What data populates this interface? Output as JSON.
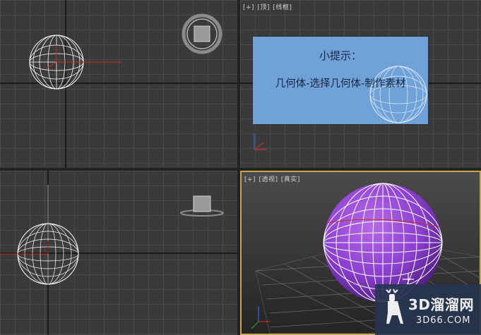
{
  "viewports": {
    "top": {
      "label_parts": [
        "[+]",
        "[顶]",
        "[线框]"
      ]
    },
    "left": {
      "label_parts": []
    },
    "front": {
      "label_parts": []
    },
    "perspective": {
      "label_parts": [
        "[+]",
        "[透视]",
        "[真实]"
      ]
    }
  },
  "tip": {
    "title": "小提示：",
    "text": "几何体-选择几何体-制作素材"
  },
  "watermark": {
    "brand": "3D溜溜网",
    "url": "3D66.COM"
  },
  "colors": {
    "grid_bg": "#3a3a3a",
    "grid_line": "#4a4a4a",
    "active_border": "#c7a64a",
    "sphere_fill": "#8b3fd1",
    "tip_bg": "#6fa2d9"
  }
}
